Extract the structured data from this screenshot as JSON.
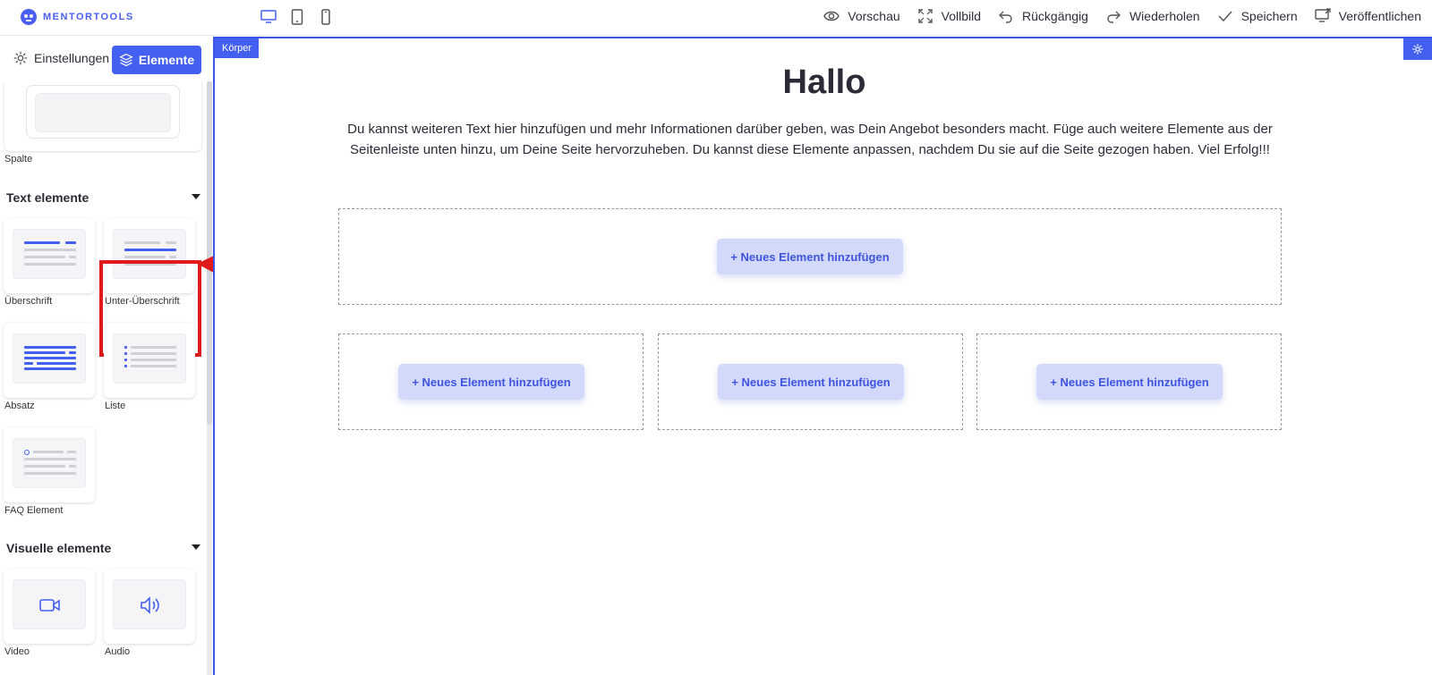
{
  "brand": {
    "logo_text": "MENTORTOOLS"
  },
  "devices": [
    "desktop-icon",
    "tablet-icon",
    "mobile-icon"
  ],
  "actions": {
    "preview": "Vorschau",
    "fullscreen": "Vollbild",
    "undo": "Rückgängig",
    "redo": "Wiederholen",
    "save": "Speichern",
    "publish": "Veröffentlichen"
  },
  "sidebar": {
    "tab_settings": "Einstellungen",
    "tab_elements": "Elemente",
    "column_label": "Spalte",
    "text_section": {
      "title": "Text elemente",
      "items": [
        "Überschrift",
        "Unter-Überschrift",
        "Absatz",
        "Liste",
        "FAQ Element"
      ]
    },
    "visual_section": {
      "title": "Visuelle elemente",
      "items": [
        "Video",
        "Audio"
      ]
    }
  },
  "canvas": {
    "body_tag": "Körper",
    "title": "Hallo",
    "text": "Du kannst weiteren Text hier hinzufügen und mehr Informationen darüber geben, was Dein Angebot besonders macht. Füge auch weitere Elemente aus der Seitenleiste unten hinzu, um Deine Seite hervorzuheben. Du kannst diese Elemente anpassen, nachdem Du sie auf die Seite gezogen haben. Viel Erfolg!!!",
    "add_element_label": "+ Neues Element hinzufügen"
  },
  "colors": {
    "accent": "#4460f0",
    "highlight": "#e01a1a",
    "button_bg": "#d3d9fb"
  }
}
